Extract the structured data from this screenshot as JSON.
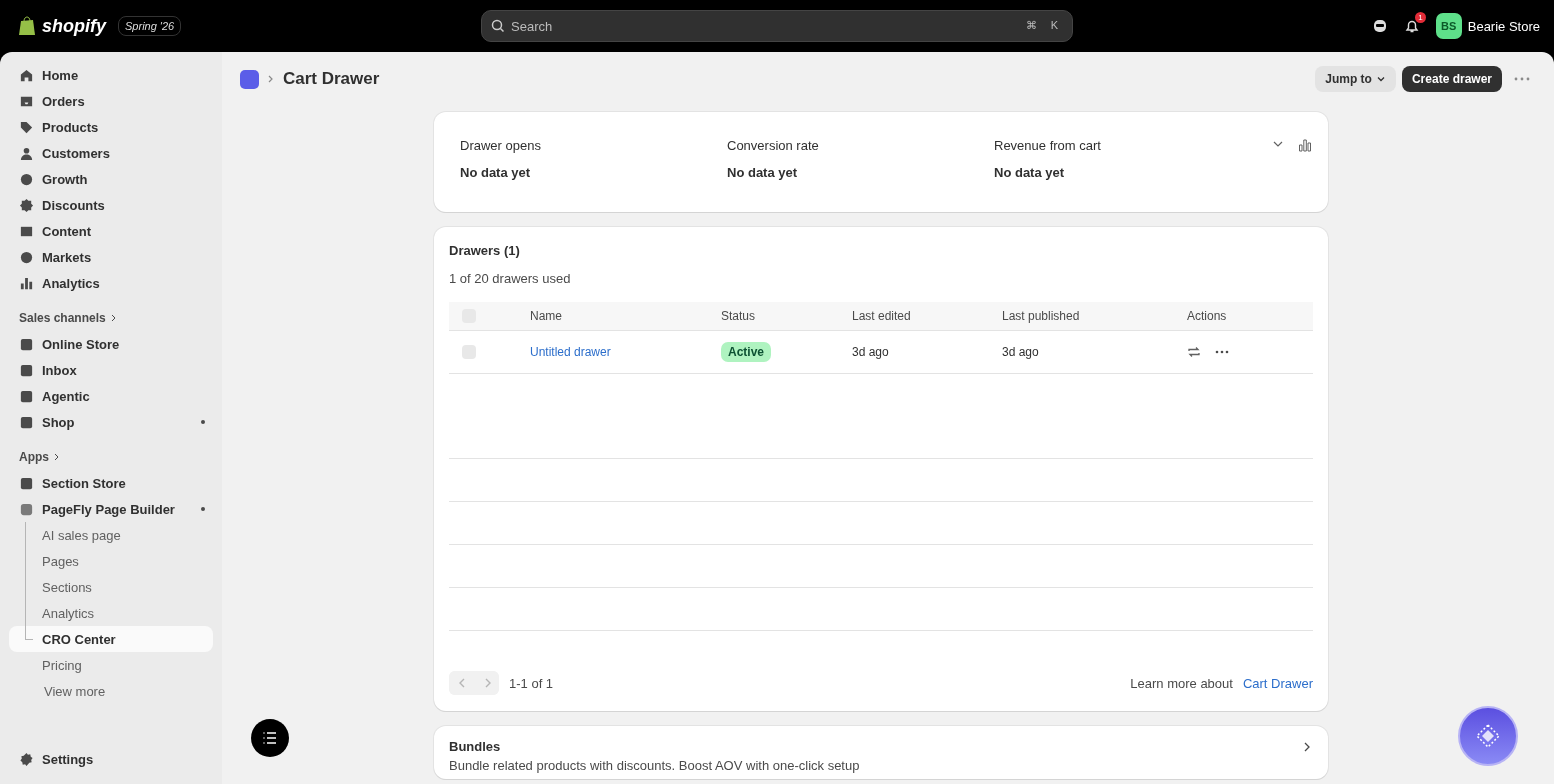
{
  "topbar": {
    "logo": "shopify",
    "edition": "Spring '26",
    "search": {
      "placeholder": "Search",
      "shortcut": [
        "⌘",
        "K"
      ]
    },
    "notification_count": "1",
    "store": {
      "initials": "BS",
      "name": "Bearie Store"
    }
  },
  "sidebar": {
    "items": [
      {
        "kind": "nav",
        "label": "Home",
        "selected": false,
        "dot": false
      },
      {
        "kind": "nav",
        "label": "Orders",
        "selected": false,
        "dot": false
      },
      {
        "kind": "nav",
        "label": "Products",
        "selected": false,
        "dot": false
      },
      {
        "kind": "nav",
        "label": "Customers",
        "selected": false,
        "dot": false
      },
      {
        "kind": "nav",
        "label": "Growth",
        "selected": false,
        "dot": false
      },
      {
        "kind": "nav",
        "label": "Discounts",
        "selected": false,
        "dot": false
      },
      {
        "kind": "nav",
        "label": "Content",
        "selected": false,
        "dot": false
      },
      {
        "kind": "nav",
        "label": "Markets",
        "selected": false,
        "dot": false
      },
      {
        "kind": "nav",
        "label": "Analytics",
        "selected": false,
        "dot": false
      },
      {
        "kind": "header",
        "label": "Sales channels"
      },
      {
        "kind": "nav",
        "label": "Online Store",
        "selected": false,
        "dot": false
      },
      {
        "kind": "nav",
        "label": "Inbox",
        "selected": false,
        "dot": false
      },
      {
        "kind": "nav",
        "label": "Agentic",
        "selected": false,
        "dot": false
      },
      {
        "kind": "nav",
        "label": "Shop",
        "selected": false,
        "dot": true
      },
      {
        "kind": "header",
        "label": "Apps"
      },
      {
        "kind": "nav",
        "label": "Section Store",
        "selected": false,
        "dot": false
      },
      {
        "kind": "nav",
        "label": "PageFly Page Builder",
        "selected": false,
        "dot": true,
        "children": [
          {
            "label": "AI sales page",
            "selected": false
          },
          {
            "label": "Pages",
            "selected": false
          },
          {
            "label": "Sections",
            "selected": false
          },
          {
            "label": "Analytics",
            "selected": false
          },
          {
            "label": "CRO Center",
            "selected": true
          },
          {
            "label": "Pricing",
            "selected": false
          }
        ]
      },
      {
        "kind": "more",
        "label": "View more"
      }
    ],
    "settings": "Settings"
  },
  "page": {
    "title": "Cart Drawer",
    "jump_button": "Jump to",
    "primary_button": "Create drawer"
  },
  "metrics": [
    {
      "label": "Drawer opens",
      "value": "No data yet"
    },
    {
      "label": "Conversion rate",
      "value": "No data yet"
    },
    {
      "label": "Revenue from cart",
      "value": "No data yet"
    }
  ],
  "drawers": {
    "title": "Drawers (1)",
    "subtitle": "1 of 20 drawers used",
    "header_checked": false,
    "columns": [
      "Name",
      "Status",
      "Last edited",
      "Last published",
      "Actions"
    ],
    "rows": [
      {
        "name": "Untitled drawer",
        "status": "Active",
        "last_edited": "3d ago",
        "last_published": "3d ago",
        "checked": false
      }
    ],
    "pagination": {
      "range": "1-1 of 1",
      "prev_disabled": true,
      "next_disabled": true
    },
    "learn_more": "Learn more about",
    "learn_link": "Cart Drawer"
  },
  "bundles": {
    "title": "Bundles",
    "description": "Bundle related products with discounts. Boost AOV with one-click setup"
  }
}
